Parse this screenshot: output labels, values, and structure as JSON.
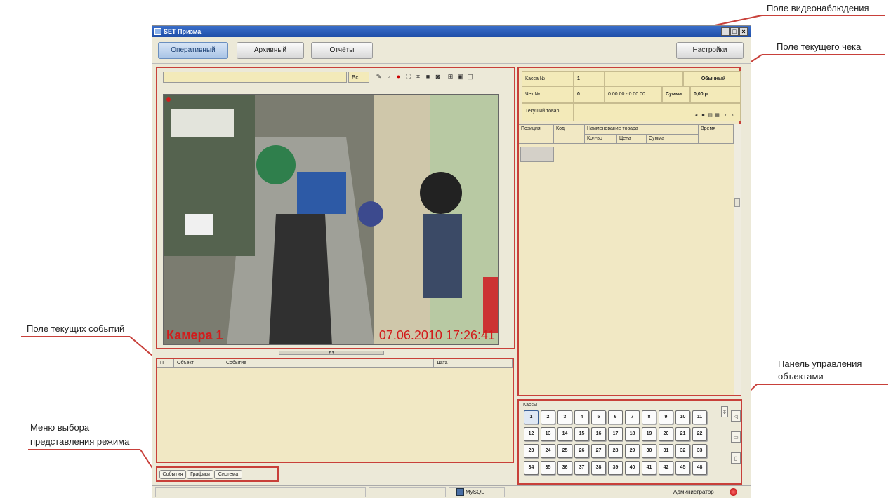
{
  "annotations": {
    "video_field": "Поле видеонаблюдения",
    "receipt_field": "Поле текущего чека",
    "events_field": "Поле текущих событий",
    "objects_panel_line1": "Панель управления",
    "objects_panel_line2": "объектами",
    "mode_menu_line1": "Меню выбора",
    "mode_menu_line2": "представления режима"
  },
  "window": {
    "title": "SET Призма",
    "controls": [
      "_",
      "□",
      "×"
    ]
  },
  "toolbar": {
    "modes": [
      "Оперативный",
      "Архивный",
      "Отчёты"
    ],
    "active_mode": "Оперативный",
    "settings_label": "Настройки"
  },
  "video": {
    "input_value": "",
    "label": "Вс",
    "tool_icons": [
      "pin-icon",
      "minus-icon",
      "record-icon",
      "fullscreen-icon",
      "camera-icon",
      "photo-icon",
      "layout-single-icon",
      "layout-quad-icon",
      "layout-grid-icon",
      "layout-split-icon"
    ],
    "camera_label": "Камера 1",
    "timestamp": "07.06.2010 17:26:41"
  },
  "events": {
    "columns": [
      "П",
      "Объект",
      "Событие",
      "Дата"
    ]
  },
  "bottom_tabs": [
    "События",
    "Графики",
    "Система"
  ],
  "status": {
    "db_label": "MySQL",
    "user": "Администратор"
  },
  "receipt": {
    "kassa_label": "Касса №",
    "kassa_value": "1",
    "type_label": "Обычный",
    "check_label": "Чек №",
    "check_value": "0",
    "time_range": "0:00:00 - 0:00:00",
    "sum_label": "Сумма",
    "sum_value": "0,00 р",
    "current_item_label": "Текущий товар",
    "columns": {
      "position": "Позиция",
      "code": "Код",
      "name": "Наименование товара",
      "time": "Время",
      "qty": "Кол-во",
      "price": "Цена",
      "sum": "Сумма"
    }
  },
  "objects": {
    "title": "Кассы",
    "kassas": [
      "1",
      "2",
      "3",
      "4",
      "5",
      "6",
      "7",
      "8",
      "9",
      "10",
      "11",
      "12",
      "13",
      "14",
      "15",
      "16",
      "17",
      "18",
      "19",
      "20",
      "21",
      "22",
      "23",
      "24",
      "25",
      "26",
      "27",
      "28",
      "29",
      "30",
      "31",
      "32",
      "33",
      "34",
      "35",
      "36",
      "37",
      "38",
      "39",
      "40",
      "41",
      "42",
      "45",
      "48"
    ],
    "selected": "1"
  },
  "colors": {
    "callout_border": "#c8403a",
    "panel_bg": "#f1e8c4",
    "window_bg": "#ece9d8",
    "titlebar": "#1f4ea8",
    "camera_text": "#d21c1c"
  }
}
